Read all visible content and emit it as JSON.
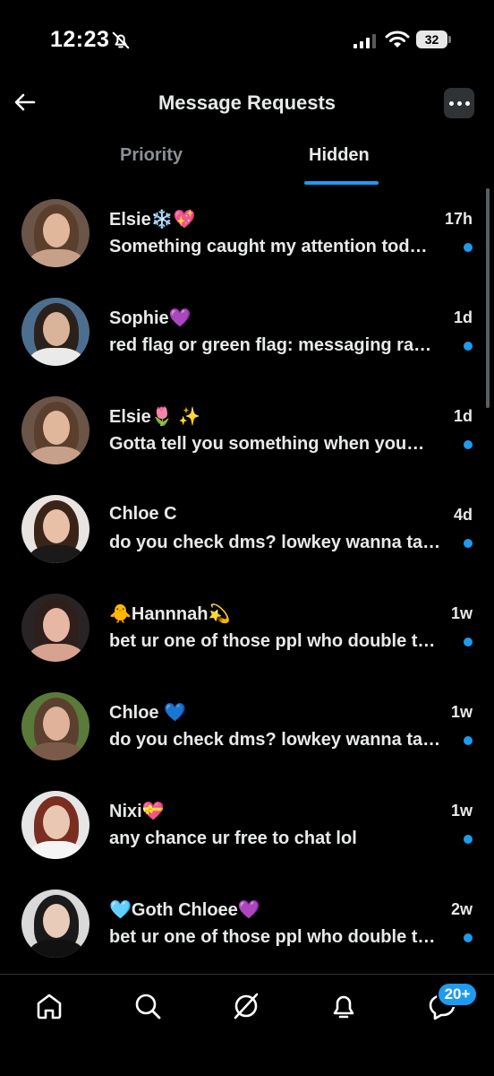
{
  "status_bar": {
    "time": "12:23",
    "battery": "32"
  },
  "header": {
    "title": "Message Requests"
  },
  "tabs": [
    {
      "label": "Priority",
      "active": false
    },
    {
      "label": "Hidden",
      "active": true
    }
  ],
  "messages": [
    {
      "name": "Elsie❄️💖",
      "time": "17h",
      "preview": "Something caught my attention tod…",
      "unread": true
    },
    {
      "name": "Sophie💜",
      "time": "1d",
      "preview": "red flag or green flag: messaging ra…",
      "unread": true
    },
    {
      "name": "Elsie🌷 ✨",
      "time": "1d",
      "preview": "Gotta tell you something when you…",
      "unread": true
    },
    {
      "name": "Chloe C",
      "time": "4d",
      "preview": "do you check dms? lowkey wanna ta…",
      "unread": true
    },
    {
      "name": "🐥Hannnah💫",
      "time": "1w",
      "preview": "bet ur one of those ppl who double t…",
      "unread": true
    },
    {
      "name": "Chloe 💙",
      "time": "1w",
      "preview": "do you check dms? lowkey wanna ta…",
      "unread": true
    },
    {
      "name": "Nixi💝",
      "time": "1w",
      "preview": "any chance ur free to chat lol",
      "unread": true
    },
    {
      "name": "🩵Goth Chloee💜",
      "time": "2w",
      "preview": "bet ur one of those ppl who double t…",
      "unread": true
    }
  ],
  "bottom_nav": {
    "items": [
      {
        "icon": "home-icon"
      },
      {
        "icon": "search-icon"
      },
      {
        "icon": "grok-icon"
      },
      {
        "icon": "notifications-icon"
      },
      {
        "icon": "messages-icon"
      }
    ],
    "messages_badge": "20+"
  },
  "colors": {
    "accent": "#1d9bf0",
    "background": "#000000",
    "text": "#e7e9ea",
    "muted": "#8b9096"
  }
}
